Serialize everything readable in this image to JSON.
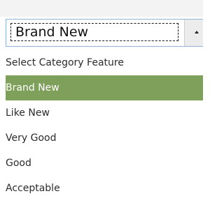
{
  "select": {
    "value": "Brand New"
  },
  "options": [
    {
      "label": "Select Category Feature",
      "selected": false
    },
    {
      "label": "Brand New",
      "selected": true
    },
    {
      "label": "Like New",
      "selected": false
    },
    {
      "label": "Very Good",
      "selected": false
    },
    {
      "label": "Good",
      "selected": false
    },
    {
      "label": "Acceptable",
      "selected": false
    }
  ],
  "colors": {
    "selected_background": "#7fa05a",
    "selected_text": "#ffffff",
    "option_text": "#2b2b2b",
    "select_border": "#8fb4d6"
  },
  "icons": {
    "dropdown_toggle": "arrow-up-icon"
  }
}
